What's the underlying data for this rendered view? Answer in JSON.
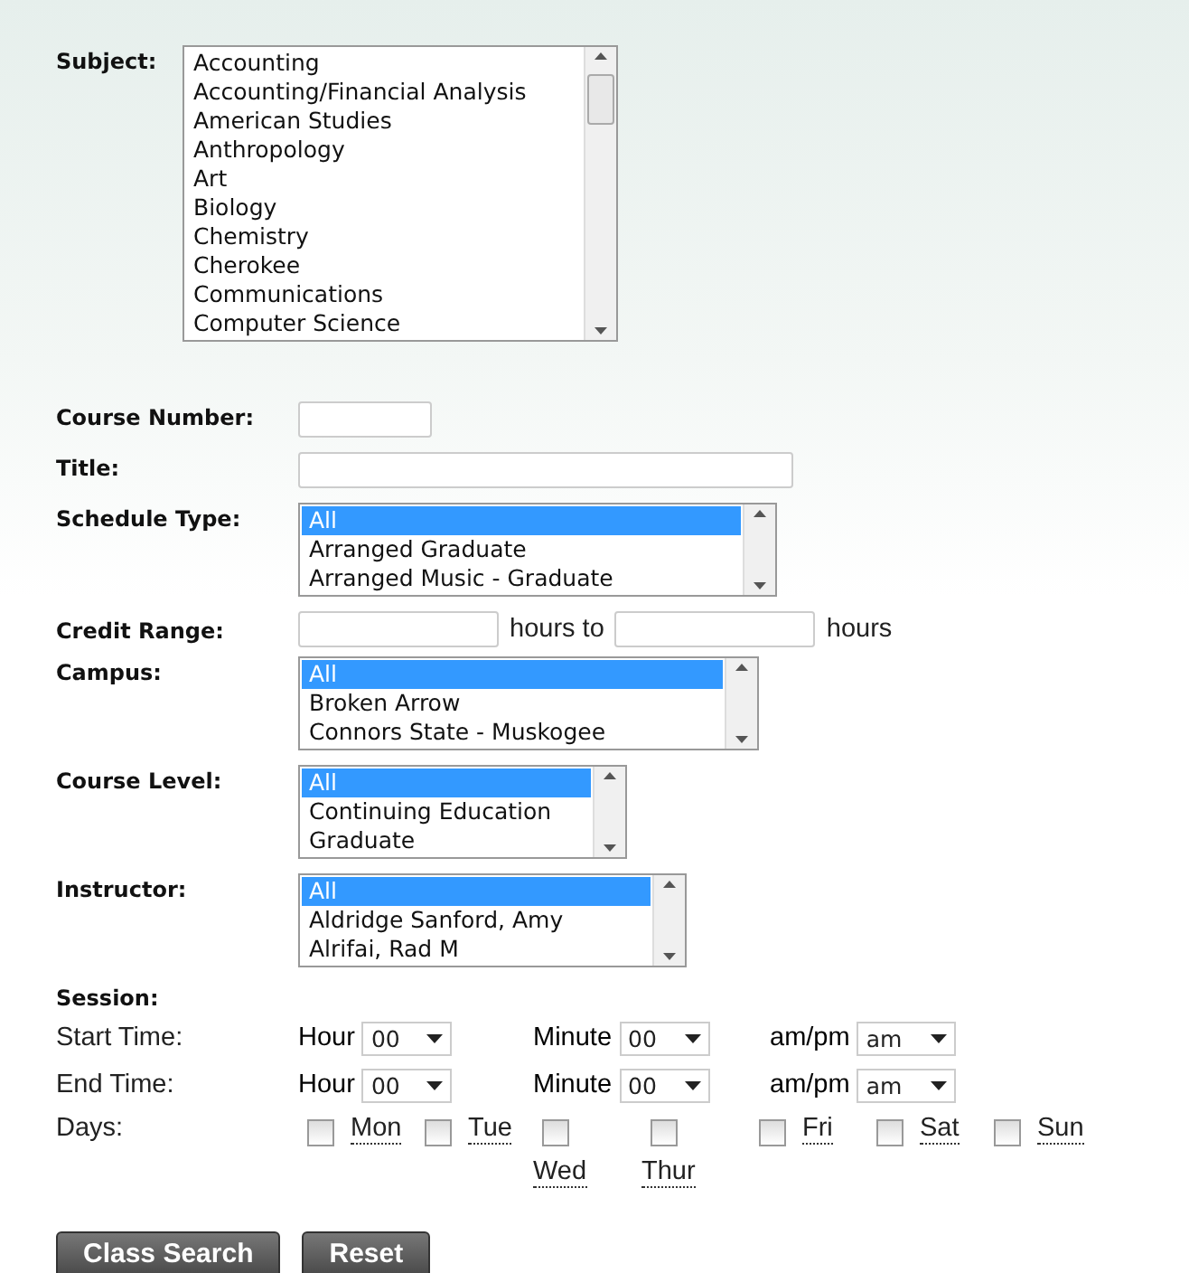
{
  "subject": {
    "label": "Subject:",
    "options": [
      {
        "text": "Accounting",
        "selected": false
      },
      {
        "text": "Accounting/Financial Analysis",
        "selected": false
      },
      {
        "text": "American Studies",
        "selected": false
      },
      {
        "text": "Anthropology",
        "selected": false
      },
      {
        "text": "Art",
        "selected": false
      },
      {
        "text": "Biology",
        "selected": false
      },
      {
        "text": "Chemistry",
        "selected": false
      },
      {
        "text": "Cherokee",
        "selected": false
      },
      {
        "text": "Communications",
        "selected": false
      },
      {
        "text": "Computer Science",
        "selected": false
      }
    ]
  },
  "fields": [
    {
      "kind": "short",
      "label": "Course Number:"
    },
    {
      "kind": "text",
      "label": "Title:"
    },
    {
      "kind": "list",
      "label": "Schedule Type:",
      "options": [
        {
          "text": "All",
          "selected": true
        },
        {
          "text": "Arranged Graduate",
          "selected": false
        },
        {
          "text": "Arranged Music - Graduate",
          "selected": false
        }
      ]
    },
    {
      "kind": "range",
      "label": "Credit Range:",
      "middle": "hours to",
      "suffix": "hours"
    },
    {
      "kind": "list",
      "label": "Campus:",
      "options": [
        {
          "text": "All",
          "selected": true
        },
        {
          "text": "Broken Arrow",
          "selected": false
        },
        {
          "text": "Connors State - Muskogee",
          "selected": false
        }
      ]
    },
    {
      "kind": "list",
      "label": "Course Level:",
      "options": [
        {
          "text": "All",
          "selected": true
        },
        {
          "text": "Continuing Education",
          "selected": false
        },
        {
          "text": "Graduate",
          "selected": false
        }
      ]
    },
    {
      "kind": "list",
      "label": "Instructor:",
      "options": [
        {
          "text": "All",
          "selected": true
        },
        {
          "text": "Aldridge Sanford, Amy",
          "selected": false
        },
        {
          "text": "Alrifai, Rad M",
          "selected": false
        }
      ]
    }
  ],
  "session": {
    "label": "Session:",
    "times": [
      {
        "label": "Start Time:",
        "hour_label": "Hour",
        "hour": "00",
        "minute_label": "Minute",
        "minute": "00",
        "ampm_label": "am/pm",
        "ampm": "am"
      },
      {
        "label": "End Time:",
        "hour_label": "Hour",
        "hour": "00",
        "minute_label": "Minute",
        "minute": "00",
        "ampm_label": "am/pm",
        "ampm": "am"
      }
    ],
    "days_label": "Days:",
    "days": [
      {
        "label": "Mon",
        "checked": false
      },
      {
        "label": "Tue",
        "checked": false
      },
      {
        "label": "Wed",
        "checked": false
      },
      {
        "label": "Thur",
        "checked": false
      },
      {
        "label": "Fri",
        "checked": false
      },
      {
        "label": "Sat",
        "checked": false
      },
      {
        "label": "Sun",
        "checked": false
      }
    ]
  },
  "buttons": [
    "Class Search",
    "Reset"
  ]
}
